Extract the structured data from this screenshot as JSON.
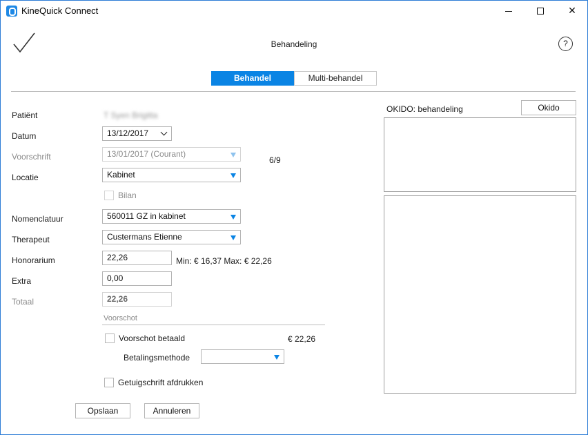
{
  "window": {
    "title": "KineQuick Connect",
    "min": "",
    "max": "",
    "close": "✕"
  },
  "header": {
    "title": "Behandeling",
    "help": "?"
  },
  "tabs": [
    {
      "label": "Behandel"
    },
    {
      "label": "Multi-behandel"
    }
  ],
  "form": {
    "patient_label": "Patiënt",
    "patient_value": "T Syen Brigitta",
    "datum_label": "Datum",
    "datum_value": "13/12/2017",
    "voorschrift_label": "Voorschrift",
    "voorschrift_value": "13/01/2017 (Courant)",
    "voorschrift_count": "6/9",
    "locatie_label": "Locatie",
    "locatie_value": "Kabinet",
    "bilan_label": "Bilan",
    "nomenclatuur_label": "Nomenclatuur",
    "nomenclatuur_value": "560011 GZ in kabinet",
    "therapeut_label": "Therapeut",
    "therapeut_value": "Custermans Etienne",
    "honorarium_label": "Honorarium",
    "honorarium_value": "22,26",
    "honorarium_range": "Min: € 16,37 Max: € 22,26",
    "extra_label": "Extra",
    "extra_value": "0,00",
    "totaal_label": "Totaal",
    "totaal_value": "22,26"
  },
  "voorschot": {
    "header": "Voorschot",
    "betaald_label": "Voorschot betaald",
    "amount": "€ 22,26",
    "methode_label": "Betalingsmethode",
    "methode_value": "",
    "getuigschrift_label": "Getuigschrift afdrukken"
  },
  "buttons": {
    "save": "Opslaan",
    "cancel": "Annuleren",
    "okido": "Okido"
  },
  "okido": {
    "title": "OKIDO: behandeling"
  },
  "colors": {
    "accent": "#0a84e4",
    "frame": "#2b7bd6"
  }
}
